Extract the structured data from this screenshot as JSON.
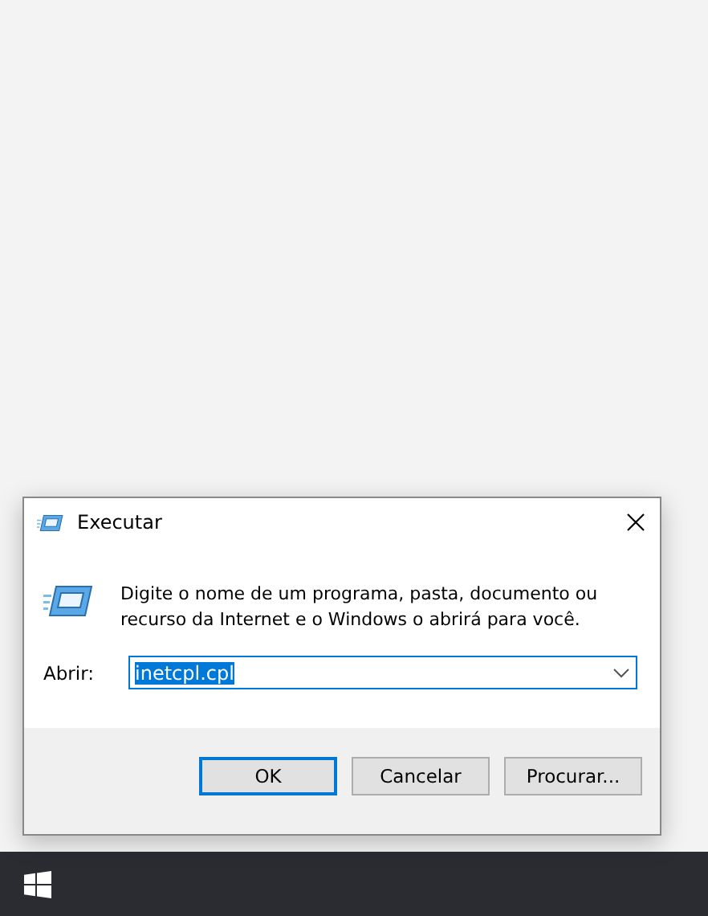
{
  "window": {
    "title": "Executar"
  },
  "description": "Digite o nome de um programa, pasta, documento ou recurso da Internet e o Windows o abrirá para você.",
  "open_field": {
    "label": "Abrir:",
    "value": "inetcpl.cpl",
    "selected": true
  },
  "buttons": [
    {
      "label": "OK",
      "default": true
    },
    {
      "label": "Cancelar",
      "default": false
    },
    {
      "label": "Procurar...",
      "default": false
    }
  ]
}
